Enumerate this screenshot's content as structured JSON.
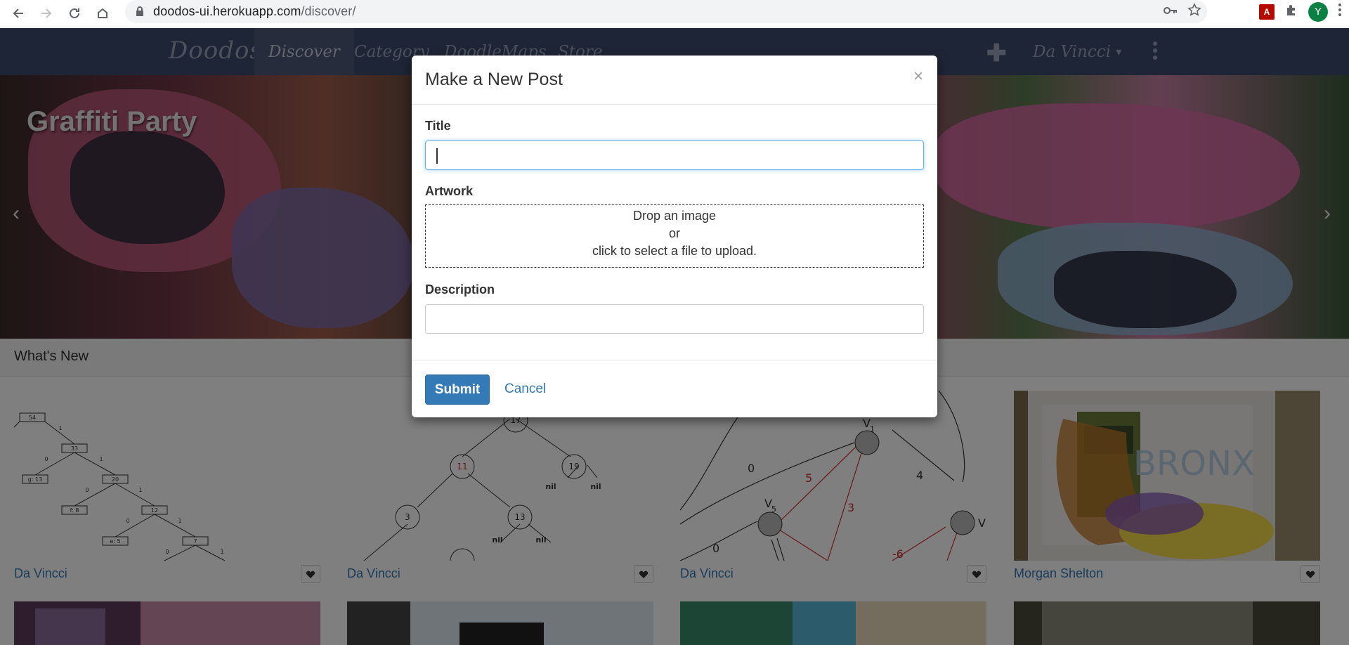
{
  "browser": {
    "url_host": "doodos-ui.herokuapp.com",
    "url_path": "/discover/",
    "profile_initial": "Y"
  },
  "site": {
    "brand": "Doodos",
    "nav": [
      "Discover",
      "Category",
      "DoodleMaps",
      "Store"
    ],
    "active_nav": "Discover",
    "user_name": "Da Vincci",
    "user_caret": "▾",
    "plus": "✚"
  },
  "hero": {
    "title": "Graffiti Party",
    "prev_arrow": "‹",
    "next_arrow": "›"
  },
  "whats_new": {
    "heading": "What's New",
    "cards": [
      {
        "author": "Da Vincci"
      },
      {
        "author": "Da Vincci"
      },
      {
        "author": "Da Vincci"
      },
      {
        "author": "Morgan Shelton"
      }
    ],
    "tree1": {
      "nodes": [
        "54",
        "33",
        "g: 13",
        "20",
        "f: 8",
        "12",
        "e: 5",
        "7"
      ],
      "edges": [
        "1",
        "0",
        "1",
        "0",
        "1",
        "0",
        "1",
        "0",
        "1"
      ]
    },
    "tree2": {
      "nodes": [
        "17",
        "11",
        "19",
        "3",
        "13"
      ],
      "nil": [
        "nil",
        "nil",
        "nil",
        "nil"
      ]
    },
    "graph": {
      "nodes": [
        "V",
        "V",
        "V"
      ],
      "subs": [
        "1",
        "5"
      ],
      "weights": [
        "0",
        "5",
        "4",
        "3",
        "0",
        "-6"
      ]
    }
  },
  "modal": {
    "title": "Make a New Post",
    "close": "×",
    "title_label": "Title",
    "title_value": "",
    "artwork_label": "Artwork",
    "dropzone_line1": "Drop an image",
    "dropzone_line2": "or",
    "dropzone_line3": "click to select a file to upload.",
    "description_label": "Description",
    "description_value": "",
    "submit_label": "Submit",
    "cancel_label": "Cancel"
  },
  "colors": {
    "navbar": "#3c4a6c",
    "primary": "#337ab7",
    "backdrop": "rgba(0,0,0,0.5)"
  }
}
